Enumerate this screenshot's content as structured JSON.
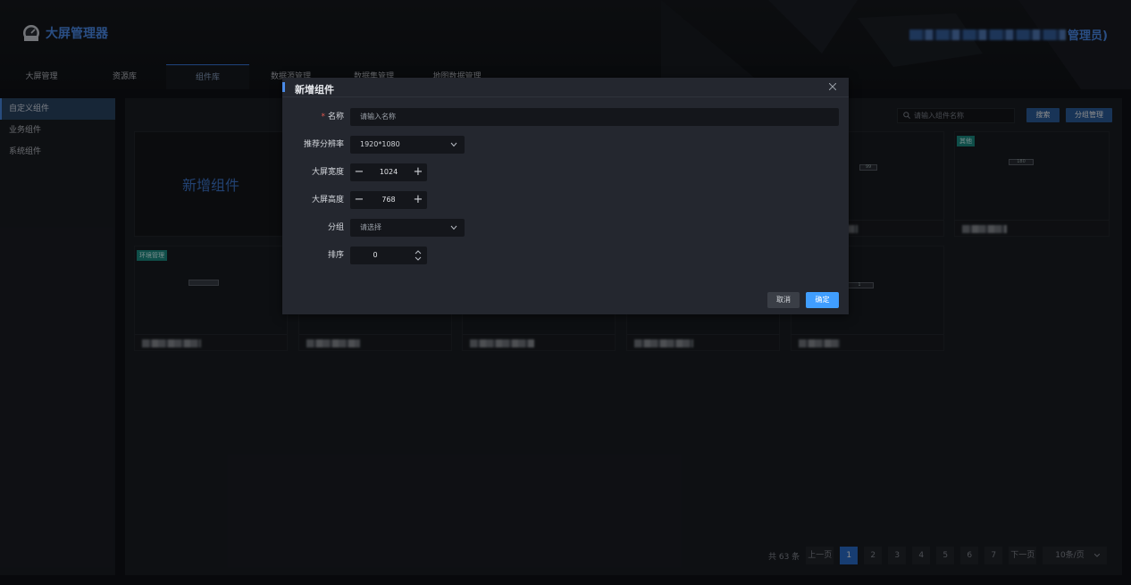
{
  "app": {
    "title": "大屏管理器",
    "user_suffix": "管理员)"
  },
  "nav": {
    "tabs": [
      {
        "label": "大屏管理"
      },
      {
        "label": "资源库"
      },
      {
        "label": "组件库"
      },
      {
        "label": "数据源管理"
      },
      {
        "label": "数据集管理"
      },
      {
        "label": "地图数据管理"
      }
    ],
    "active": "组件库"
  },
  "sidebar": {
    "items": [
      {
        "label": "自定义组件"
      },
      {
        "label": "业务组件"
      },
      {
        "label": "系统组件"
      }
    ],
    "active": "自定义组件"
  },
  "toolbar": {
    "search_placeholder": "请输入组件名称",
    "search_button": "搜索",
    "group_button": "分组管理"
  },
  "grid": {
    "new_card_label": "新增组件",
    "tags": {
      "other": "其他",
      "env": "环境管理"
    },
    "mini_labels": {
      "a": "99",
      "b": "180",
      "c": "1"
    }
  },
  "pagination": {
    "total": "共 63 条",
    "prev": "上一页",
    "next": "下一页",
    "pages": [
      "1",
      "2",
      "3",
      "4",
      "5",
      "6",
      "7"
    ],
    "current": "1",
    "page_size": "10条/页"
  },
  "modal": {
    "title": "新增组件",
    "fields": {
      "name": {
        "label": "名称",
        "placeholder": "请输入名称",
        "required": "*"
      },
      "resolution": {
        "label": "推荐分辨率",
        "value": "1920*1080"
      },
      "width": {
        "label": "大屏宽度",
        "value": "1024"
      },
      "height": {
        "label": "大屏高度",
        "value": "768"
      },
      "group": {
        "label": "分组",
        "placeholder": "请选择"
      },
      "sort": {
        "label": "排序",
        "value": "0"
      }
    },
    "cancel": "取消",
    "confirm": "确定"
  },
  "colors": {
    "accent": "#4a8ae6",
    "confirm": "#409eff",
    "tag": "#1c8f86"
  }
}
